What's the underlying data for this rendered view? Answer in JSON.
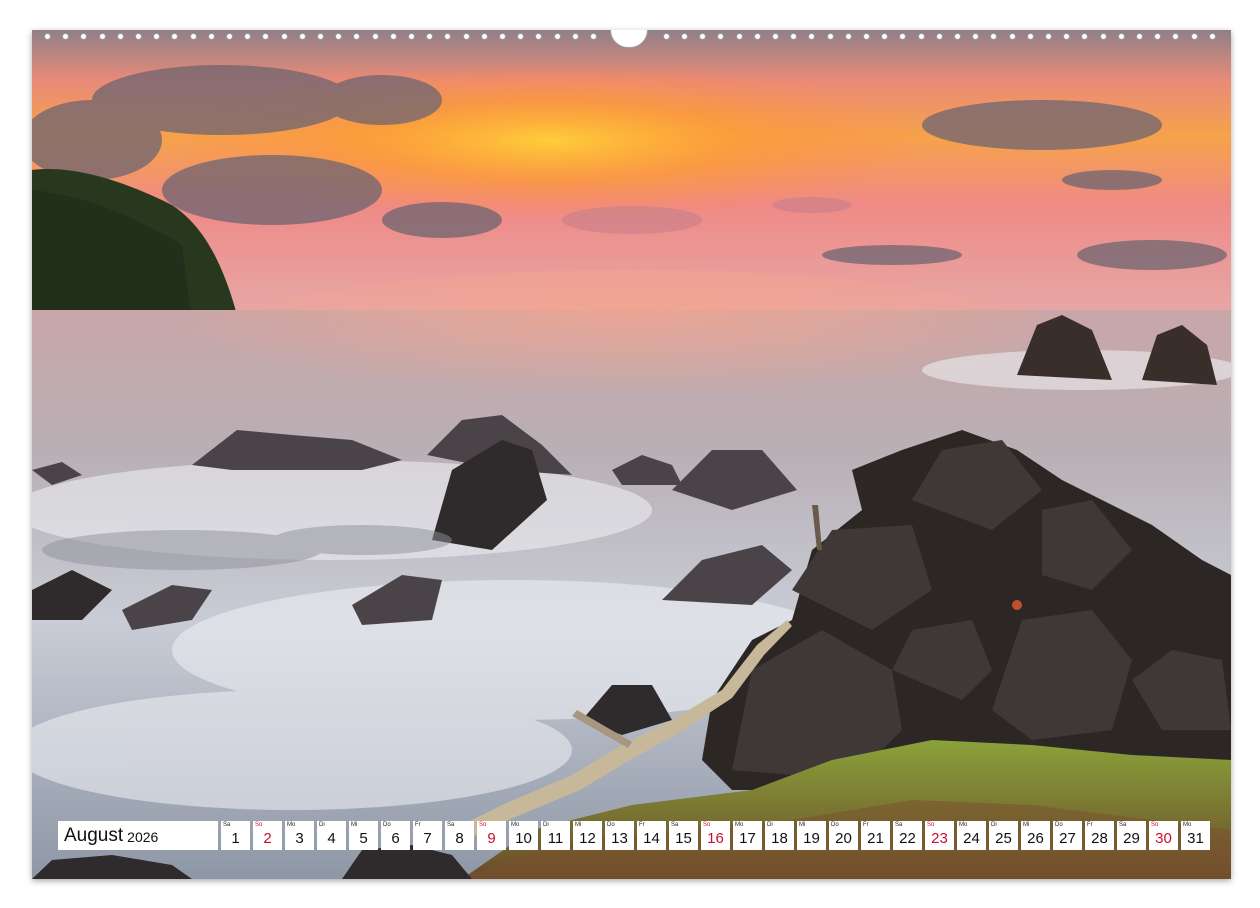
{
  "calendar": {
    "month": "August",
    "year": "2026",
    "days": [
      {
        "abbr": "Sa",
        "num": "1",
        "sunday": false
      },
      {
        "abbr": "So",
        "num": "2",
        "sunday": true
      },
      {
        "abbr": "Mo",
        "num": "3",
        "sunday": false
      },
      {
        "abbr": "Di",
        "num": "4",
        "sunday": false
      },
      {
        "abbr": "Mi",
        "num": "5",
        "sunday": false
      },
      {
        "abbr": "Do",
        "num": "6",
        "sunday": false
      },
      {
        "abbr": "Fr",
        "num": "7",
        "sunday": false
      },
      {
        "abbr": "Sa",
        "num": "8",
        "sunday": false
      },
      {
        "abbr": "So",
        "num": "9",
        "sunday": true
      },
      {
        "abbr": "Mo",
        "num": "10",
        "sunday": false
      },
      {
        "abbr": "Di",
        "num": "11",
        "sunday": false
      },
      {
        "abbr": "Mi",
        "num": "12",
        "sunday": false
      },
      {
        "abbr": "Do",
        "num": "13",
        "sunday": false
      },
      {
        "abbr": "Fr",
        "num": "14",
        "sunday": false
      },
      {
        "abbr": "Sa",
        "num": "15",
        "sunday": false
      },
      {
        "abbr": "So",
        "num": "16",
        "sunday": true
      },
      {
        "abbr": "Mo",
        "num": "17",
        "sunday": false
      },
      {
        "abbr": "Di",
        "num": "18",
        "sunday": false
      },
      {
        "abbr": "Mi",
        "num": "19",
        "sunday": false
      },
      {
        "abbr": "Do",
        "num": "20",
        "sunday": false
      },
      {
        "abbr": "Fr",
        "num": "21",
        "sunday": false
      },
      {
        "abbr": "Sa",
        "num": "22",
        "sunday": false
      },
      {
        "abbr": "So",
        "num": "23",
        "sunday": true
      },
      {
        "abbr": "Mo",
        "num": "24",
        "sunday": false
      },
      {
        "abbr": "Di",
        "num": "25",
        "sunday": false
      },
      {
        "abbr": "Mi",
        "num": "26",
        "sunday": false
      },
      {
        "abbr": "Do",
        "num": "27",
        "sunday": false
      },
      {
        "abbr": "Fr",
        "num": "28",
        "sunday": false
      },
      {
        "abbr": "Sa",
        "num": "29",
        "sunday": false
      },
      {
        "abbr": "So",
        "num": "30",
        "sunday": true
      },
      {
        "abbr": "Mo",
        "num": "31",
        "sunday": false
      }
    ]
  },
  "colors": {
    "sunday": "#c8102e",
    "sky_top": "#8f7a86",
    "sky_glow": "#f6a23a",
    "sea": "#b9b3b6",
    "rock": "#3b3533",
    "grass": "#6f8a2e"
  },
  "photo": {
    "scene": "coastal-sunset",
    "icon": "photo"
  }
}
